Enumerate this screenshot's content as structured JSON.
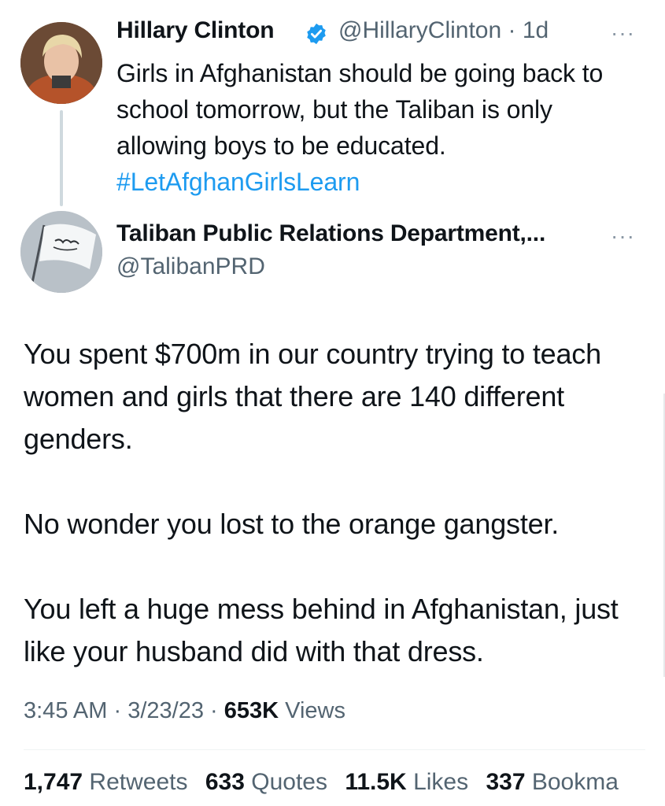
{
  "parent_tweet": {
    "author_name": "Hillary Clinton",
    "handle": "@HillaryClinton",
    "separator": "·",
    "time_ago": "1d",
    "more": "···",
    "text_lines": [
      "Girls in Afghanistan should be going back to",
      "school tomorrow, but the Taliban is only",
      "allowing boys to be educated."
    ],
    "hashtag": "#LetAfghanGirlsLearn",
    "verified_icon": "verified-badge-icon",
    "verified_color": "#1d9bf0"
  },
  "reply_tweet": {
    "author_name": "Taliban Public Relations Department,...",
    "handle": "@TalibanPRD",
    "more": "···",
    "paragraphs": [
      "You spent $700m in our country trying to teach women and girls that there are 140 different genders.",
      "No wonder you lost to the orange gangster.",
      "You left a huge mess behind in Afghanistan, just like your husband did with that dress."
    ],
    "time": "3:45 AM",
    "date": "3/23/23",
    "views_count": "653K",
    "views_label": "Views",
    "stats": {
      "retweets_count": "1,747",
      "retweets_label": "Retweets",
      "quotes_count": "633",
      "quotes_label": "Quotes",
      "likes_count": "11.5K",
      "likes_label": "Likes",
      "bookmarks_count": "337",
      "bookmarks_label": "Bookma"
    }
  },
  "colors": {
    "text": "#0f1419",
    "secondary": "#536471",
    "link": "#1d9bf0",
    "thread_line": "#cfd9de"
  }
}
